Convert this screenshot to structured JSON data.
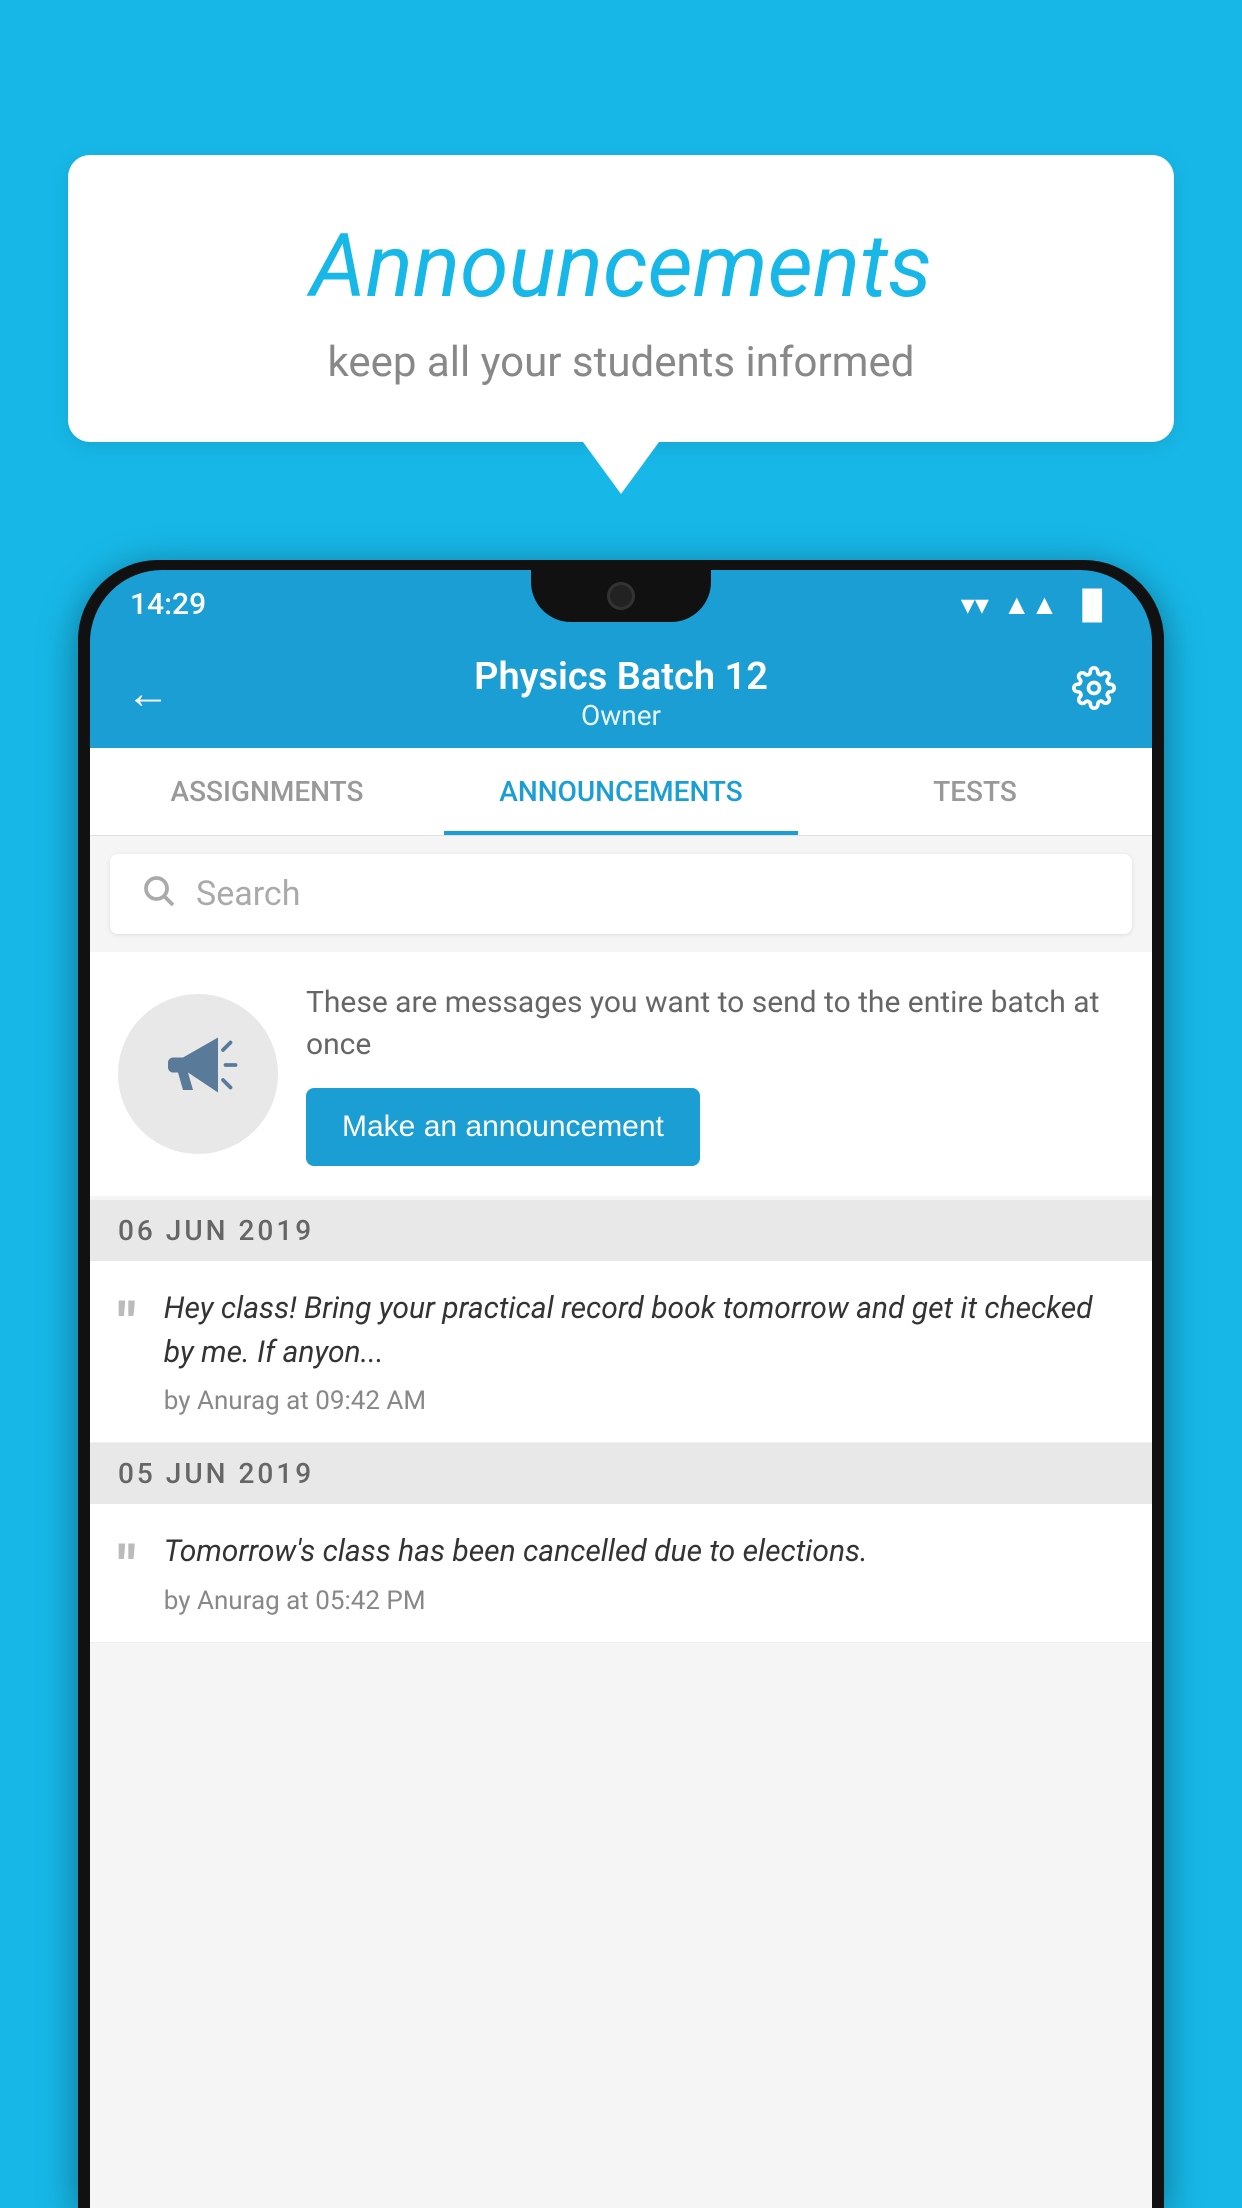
{
  "background_color": "#17b8e8",
  "speech_bubble": {
    "title": "Announcements",
    "subtitle": "keep all your students informed"
  },
  "status_bar": {
    "time": "14:29",
    "wifi": "▼",
    "signal": "▲",
    "battery": "▐"
  },
  "header": {
    "title": "Physics Batch 12",
    "subtitle": "Owner",
    "back_label": "←",
    "settings_label": "⚙"
  },
  "tabs": [
    {
      "label": "ASSIGNMENTS",
      "active": false
    },
    {
      "label": "ANNOUNCEMENTS",
      "active": true
    },
    {
      "label": "TESTS",
      "active": false
    }
  ],
  "search": {
    "placeholder": "Search"
  },
  "announcement_promo": {
    "description": "These are messages you want to send to the entire batch at once",
    "button_label": "Make an announcement"
  },
  "announcements": [
    {
      "date": "06  JUN  2019",
      "items": [
        {
          "content": "Hey class! Bring your practical record book tomorrow and get it checked by me. If anyon...",
          "meta": "by Anurag at 09:42 AM"
        }
      ]
    },
    {
      "date": "05  JUN  2019",
      "items": [
        {
          "content": "Tomorrow's class has been cancelled due to elections.",
          "meta": "by Anurag at 05:42 PM"
        }
      ]
    }
  ]
}
